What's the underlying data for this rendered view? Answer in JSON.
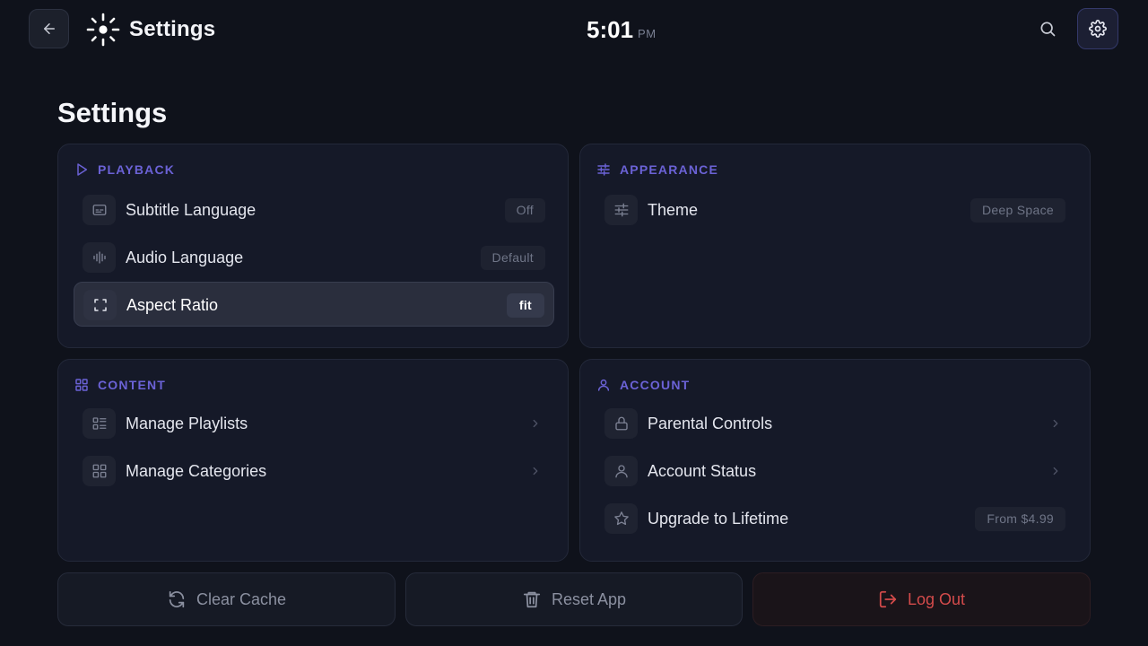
{
  "app_title": "Settings",
  "clock": {
    "time": "5:01",
    "ampm": "PM"
  },
  "page_title": "Settings",
  "sections": {
    "playback": {
      "title": "PLAYBACK",
      "rows": [
        {
          "label": "Subtitle Language",
          "value": "Off"
        },
        {
          "label": "Audio Language",
          "value": "Default"
        },
        {
          "label": "Aspect Ratio",
          "value": "fit"
        }
      ]
    },
    "appearance": {
      "title": "APPEARANCE",
      "rows": [
        {
          "label": "Theme",
          "value": "Deep Space"
        }
      ]
    },
    "content": {
      "title": "CONTENT",
      "rows": [
        {
          "label": "Manage Playlists"
        },
        {
          "label": "Manage Categories"
        }
      ]
    },
    "account": {
      "title": "ACCOUNT",
      "rows": [
        {
          "label": "Parental Controls"
        },
        {
          "label": "Account Status"
        },
        {
          "label": "Upgrade to Lifetime",
          "value": "From $4.99"
        }
      ]
    }
  },
  "actions": {
    "clear_cache": "Clear Cache",
    "reset_app": "Reset App",
    "log_out": "Log Out"
  },
  "colors": {
    "accent": "#6b62d6",
    "danger": "#d44b4b",
    "background": "#0f121b",
    "card": "#151928"
  },
  "icons": {
    "back": "arrow-left-icon",
    "logo": "sun-burst-icon",
    "search": "search-icon",
    "settings": "gear-icon"
  }
}
